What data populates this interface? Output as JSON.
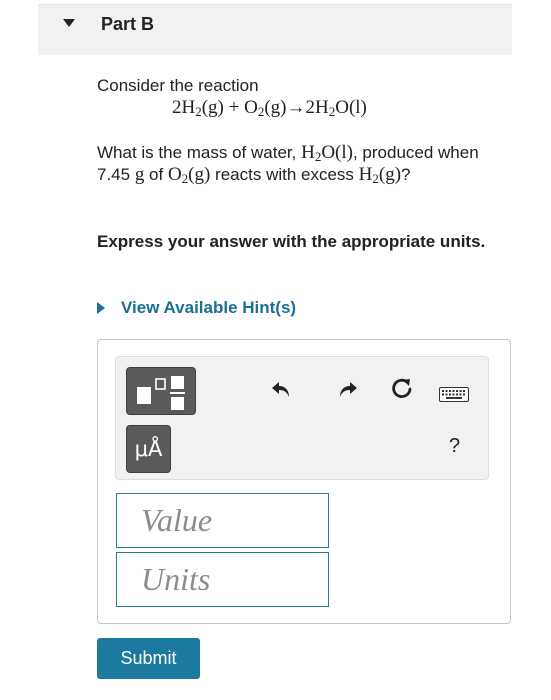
{
  "part": {
    "title": "Part B"
  },
  "problem": {
    "intro": "Consider the reaction",
    "equation": {
      "lhs_coef1": "2H",
      "lhs_sub1": "2",
      "lhs_state1": "(g)",
      "plus": "+",
      "lhs_sp2": "O",
      "lhs_sub2": "2",
      "lhs_state2": "(g)",
      "arrow": "→",
      "rhs_coef": "2H",
      "rhs_sub": "2",
      "rhs_rest": "O(l)"
    },
    "question": {
      "q1": "What is the mass of water, ",
      "water_h": "H",
      "water_sub": "2",
      "water_rest": "O(l)",
      "q2": ", produced when 7.45 ",
      "unit_g": "g",
      "q3": " of ",
      "o2_o": "O",
      "o2_sub": "2",
      "o2_state": "(g)",
      "q4": " reacts with excess ",
      "h2_h": "H",
      "h2_sub": "2",
      "h2_state": "(g)",
      "q5": "?"
    },
    "instruction": "Express your answer with the appropriate units."
  },
  "hints": {
    "label": "View Available Hint(s)"
  },
  "toolbar": {
    "units_label": "μÅ",
    "help_label": "?"
  },
  "answer": {
    "value_placeholder": "Value",
    "units_placeholder": "Units"
  },
  "submit": {
    "label": "Submit"
  }
}
